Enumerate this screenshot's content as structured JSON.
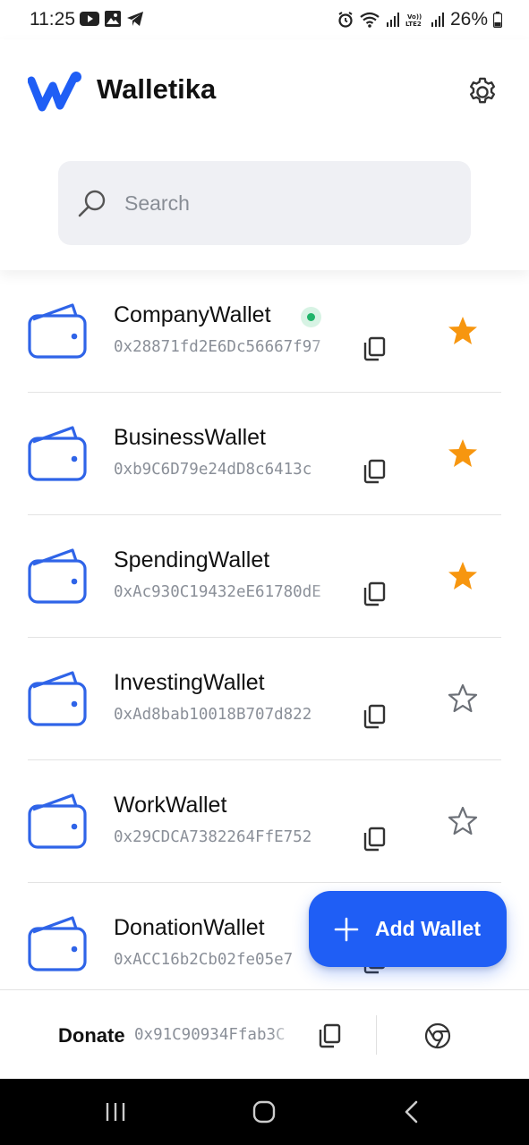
{
  "status_bar": {
    "time": "11:25",
    "battery": "26%"
  },
  "header": {
    "app_title": "Walletika",
    "logo_icon": "walletika-w-logo",
    "settings_icon": "gear-icon"
  },
  "search": {
    "placeholder": "Search",
    "value": ""
  },
  "wallets": [
    {
      "name": "CompanyWallet",
      "address": "0x28871fd2E6Dc56667f97",
      "favorite": true,
      "connected": true
    },
    {
      "name": "BusinessWallet",
      "address": "0xb9C6D79e24dD8c6413c",
      "favorite": true,
      "connected": false
    },
    {
      "name": "SpendingWallet",
      "address": "0xAc930C19432eE61780dE",
      "favorite": true,
      "connected": false
    },
    {
      "name": "InvestingWallet",
      "address": "0xAd8bab10018B707d822",
      "favorite": false,
      "connected": false
    },
    {
      "name": "WorkWallet",
      "address": "0x29CDCA7382264FfE752",
      "favorite": false,
      "connected": false
    },
    {
      "name": "DonationWallet",
      "address": "0xACC16b2Cb02fe05e7",
      "favorite": false,
      "connected": false
    }
  ],
  "fab": {
    "label": "Add Wallet"
  },
  "donate": {
    "label": "Donate",
    "address": "0x91C90934Ffab3C"
  },
  "colors": {
    "accent": "#1f5ef5",
    "wallet_icon": "#2f64e8",
    "star_filled": "#f7960f",
    "star_outline": "#6b6f76",
    "online": "#20b46a"
  }
}
